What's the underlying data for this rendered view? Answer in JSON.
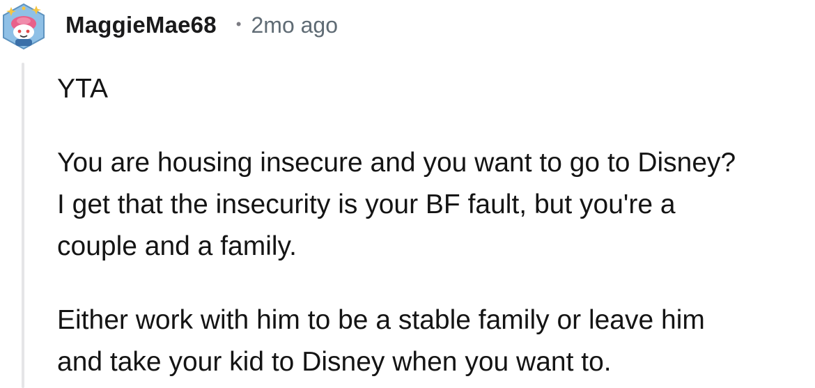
{
  "comment": {
    "author": "MaggieMae68",
    "separator": "•",
    "timestamp": "2mo ago",
    "avatar_icon": "snoo-avatar-icon",
    "paragraphs": [
      "YTA",
      "You are housing insecure and you want to go to Disney?\nI get that the insecurity is your BF fault, but you're a\ncouple and a family.",
      "Either work with him to be a stable family or leave him\nand take your kid to Disney when you want to."
    ]
  },
  "colors": {
    "thread_line": "#e5e5e7",
    "author_text": "#1a1a1b",
    "timestamp_text": "#5f6b74",
    "avatar_hex": "#7fb3d9"
  }
}
